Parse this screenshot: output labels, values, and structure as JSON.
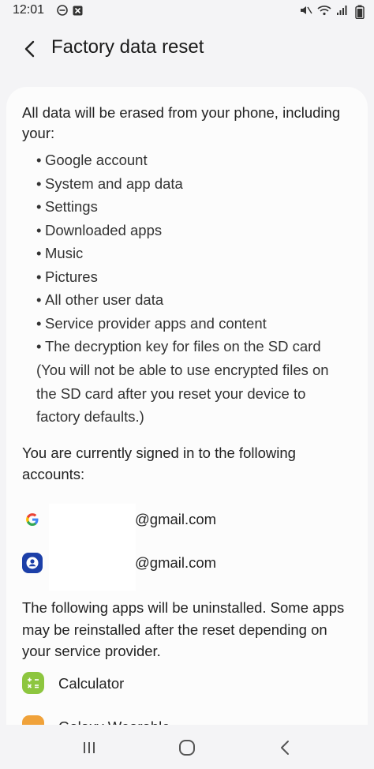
{
  "status_bar": {
    "time": "12:01"
  },
  "header": {
    "title": "Factory data reset"
  },
  "content": {
    "intro": "All data will be erased from your phone, including your:",
    "bullets": [
      "Google account",
      "System and app data",
      "Settings",
      "Downloaded apps",
      "Music",
      "Pictures",
      "All other user data",
      "Service provider apps and content",
      "The decryption key for files on the SD card"
    ],
    "note": "(You will not be able to use encrypted files on the SD card after you reset your device to factory defaults.)",
    "accounts_intro": "You are currently signed in to the following accounts:",
    "accounts": [
      {
        "icon": "google-icon",
        "email": "@gmail.com"
      },
      {
        "icon": "samsung-account-icon",
        "email": "@gmail.com"
      }
    ],
    "apps_intro": "The following apps will be uninstalled. Some apps may be reinstalled after the reset depending on your service provider.",
    "apps": [
      {
        "icon": "calculator-icon",
        "name": "Calculator"
      },
      {
        "icon": "galaxy-wearable-icon",
        "name": "Galaxy Wearable"
      }
    ]
  },
  "nav_bar": {
    "icons": [
      "recent-apps-icon",
      "home-icon",
      "back-icon"
    ]
  },
  "colors": {
    "background": "#f4f4f6",
    "card": "#fcfcfc",
    "calculator": "#8dc63f",
    "samsung_account": "#1c3fa8",
    "wearable": "#f0a23a"
  }
}
